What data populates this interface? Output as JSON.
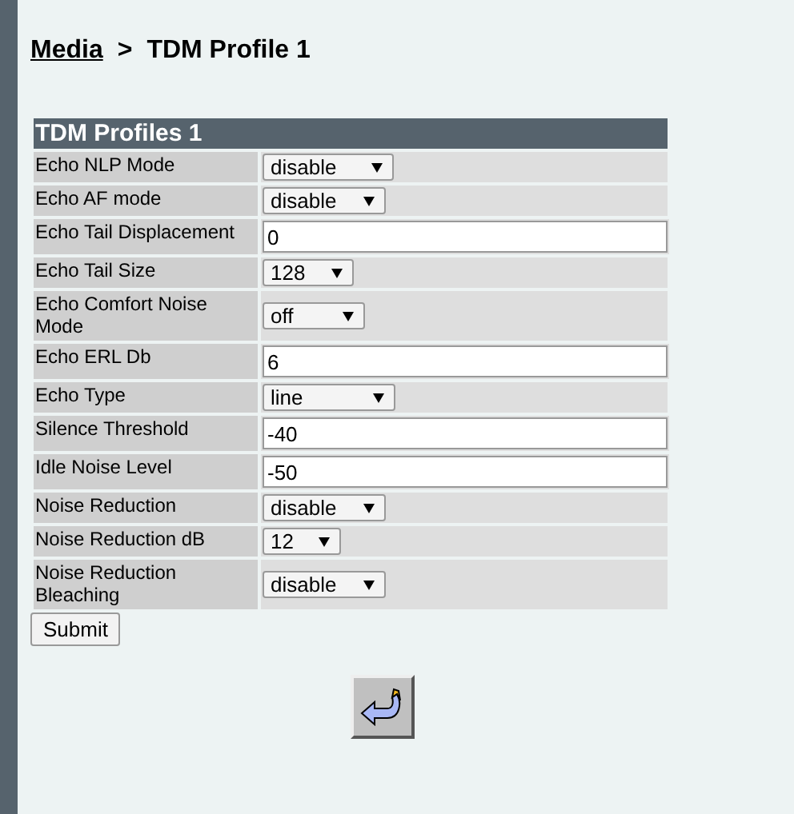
{
  "breadcrumb": {
    "link": "Media",
    "separator": ">",
    "current": "TDM Profile 1"
  },
  "table": {
    "title": "TDM Profiles 1",
    "rows": [
      {
        "label": "Echo NLP Mode",
        "kind": "select",
        "value": "disable"
      },
      {
        "label": "Echo AF mode",
        "kind": "select",
        "value": "disable"
      },
      {
        "label": "Echo Tail Displacement",
        "kind": "text",
        "value": "0"
      },
      {
        "label": "Echo Tail Size",
        "kind": "select",
        "value": "128"
      },
      {
        "label": "Echo Comfort Noise Mode",
        "kind": "select",
        "value": "off"
      },
      {
        "label": "Echo ERL Db",
        "kind": "text",
        "value": "6"
      },
      {
        "label": "Echo Type",
        "kind": "select",
        "value": "line"
      },
      {
        "label": "Silence Threshold",
        "kind": "text",
        "value": "-40"
      },
      {
        "label": "Idle Noise Level",
        "kind": "text",
        "value": "-50"
      },
      {
        "label": "Noise Reduction",
        "kind": "select",
        "value": "disable"
      },
      {
        "label": "Noise Reduction dB",
        "kind": "select",
        "value": "12"
      },
      {
        "label": "Noise Reduction Bleaching",
        "kind": "select",
        "value": "disable"
      }
    ]
  },
  "submit": "Submit"
}
